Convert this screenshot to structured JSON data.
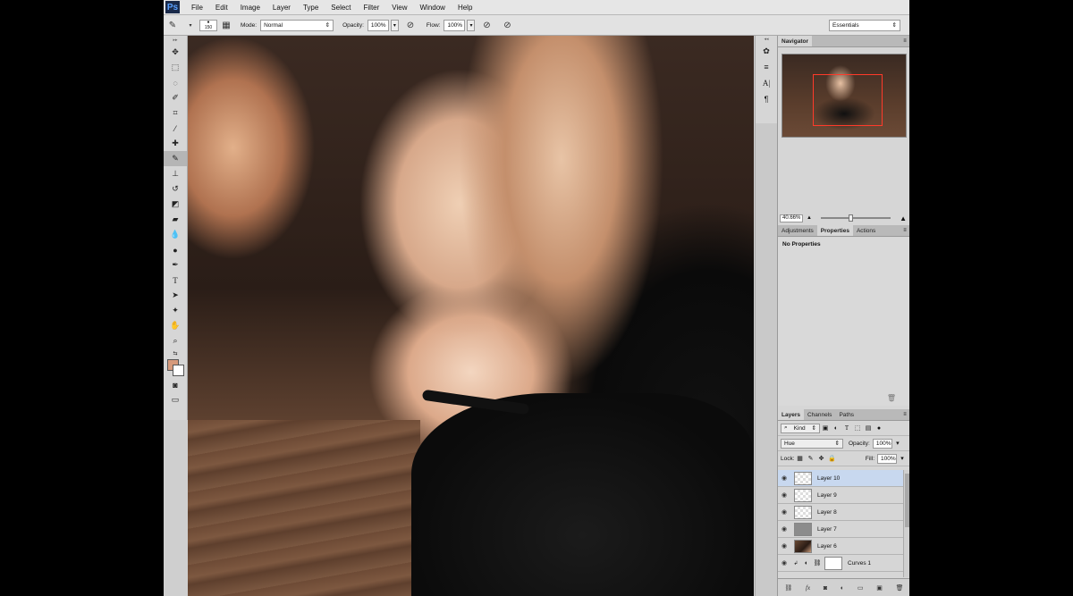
{
  "app": {
    "logo": "Ps"
  },
  "menu": [
    "File",
    "Edit",
    "Image",
    "Layer",
    "Type",
    "Select",
    "Filter",
    "View",
    "Window",
    "Help"
  ],
  "options_bar": {
    "brush_size": "150",
    "mode_label": "Mode:",
    "mode_value": "Normal",
    "opacity_label": "Opacity:",
    "opacity_value": "100%",
    "flow_label": "Flow:",
    "flow_value": "100%",
    "workspace": "Essentials"
  },
  "tools": [
    "move-tool",
    "marquee-tool",
    "lasso-tool",
    "quick-select-tool",
    "crop-tool",
    "eyedropper-tool",
    "healing-brush-tool",
    "brush-tool",
    "clone-stamp-tool",
    "history-brush-tool",
    "eraser-tool",
    "gradient-tool",
    "blur-tool",
    "dodge-tool",
    "pen-tool",
    "type-tool",
    "path-select-tool",
    "shape-tool",
    "hand-tool",
    "zoom-tool"
  ],
  "colors": {
    "foreground": "#d69a7c",
    "background": "#ffffff",
    "nav_box": "#ff3a2a",
    "selected_layer": "#c8d8ef"
  },
  "navigator": {
    "title": "Navigator",
    "zoom": "40.66%"
  },
  "properties": {
    "tabs": [
      "Adjustments",
      "Properties",
      "Actions"
    ],
    "active_tab": "Properties",
    "body": "No Properties"
  },
  "layers": {
    "tabs": [
      "Layers",
      "Channels",
      "Paths"
    ],
    "kind_label": "Kind",
    "blend_mode": "Hue",
    "opacity_label": "Opacity:",
    "opacity_value": "100%",
    "lock_label": "Lock:",
    "fill_label": "Fill:",
    "fill_value": "100%",
    "items": [
      {
        "name": "Layer 10",
        "thumb": "transparent",
        "selected": true
      },
      {
        "name": "Layer 9",
        "thumb": "transparent",
        "selected": false
      },
      {
        "name": "Layer 8",
        "thumb": "transparent",
        "selected": false
      },
      {
        "name": "Layer 7",
        "thumb": "gray",
        "selected": false
      },
      {
        "name": "Layer 6",
        "thumb": "photo",
        "selected": false
      },
      {
        "name": "Curves 1",
        "thumb": "adjustment",
        "selected": false
      }
    ]
  }
}
